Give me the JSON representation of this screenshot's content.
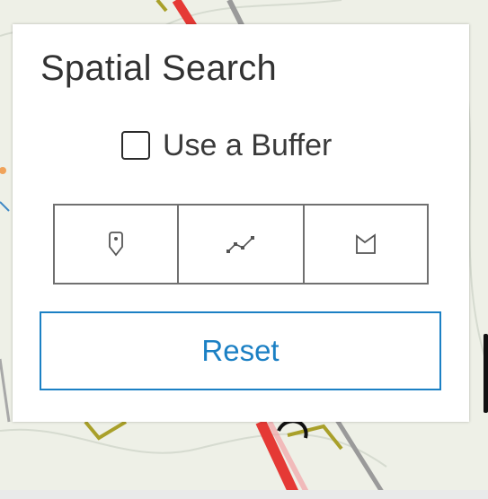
{
  "panel": {
    "title": "Spatial Search",
    "buffer_label": "Use a Buffer",
    "buffer_checked": false,
    "tools": [
      {
        "name": "point-tool",
        "icon": "map-pin-icon"
      },
      {
        "name": "line-tool",
        "icon": "polyline-icon"
      },
      {
        "name": "polygon-tool",
        "icon": "polygon-icon"
      }
    ],
    "reset_label": "Reset"
  },
  "colors": {
    "accent": "#1b80c4",
    "text": "#323232",
    "tool_border": "#707070",
    "map_background": "#eef0e7"
  }
}
